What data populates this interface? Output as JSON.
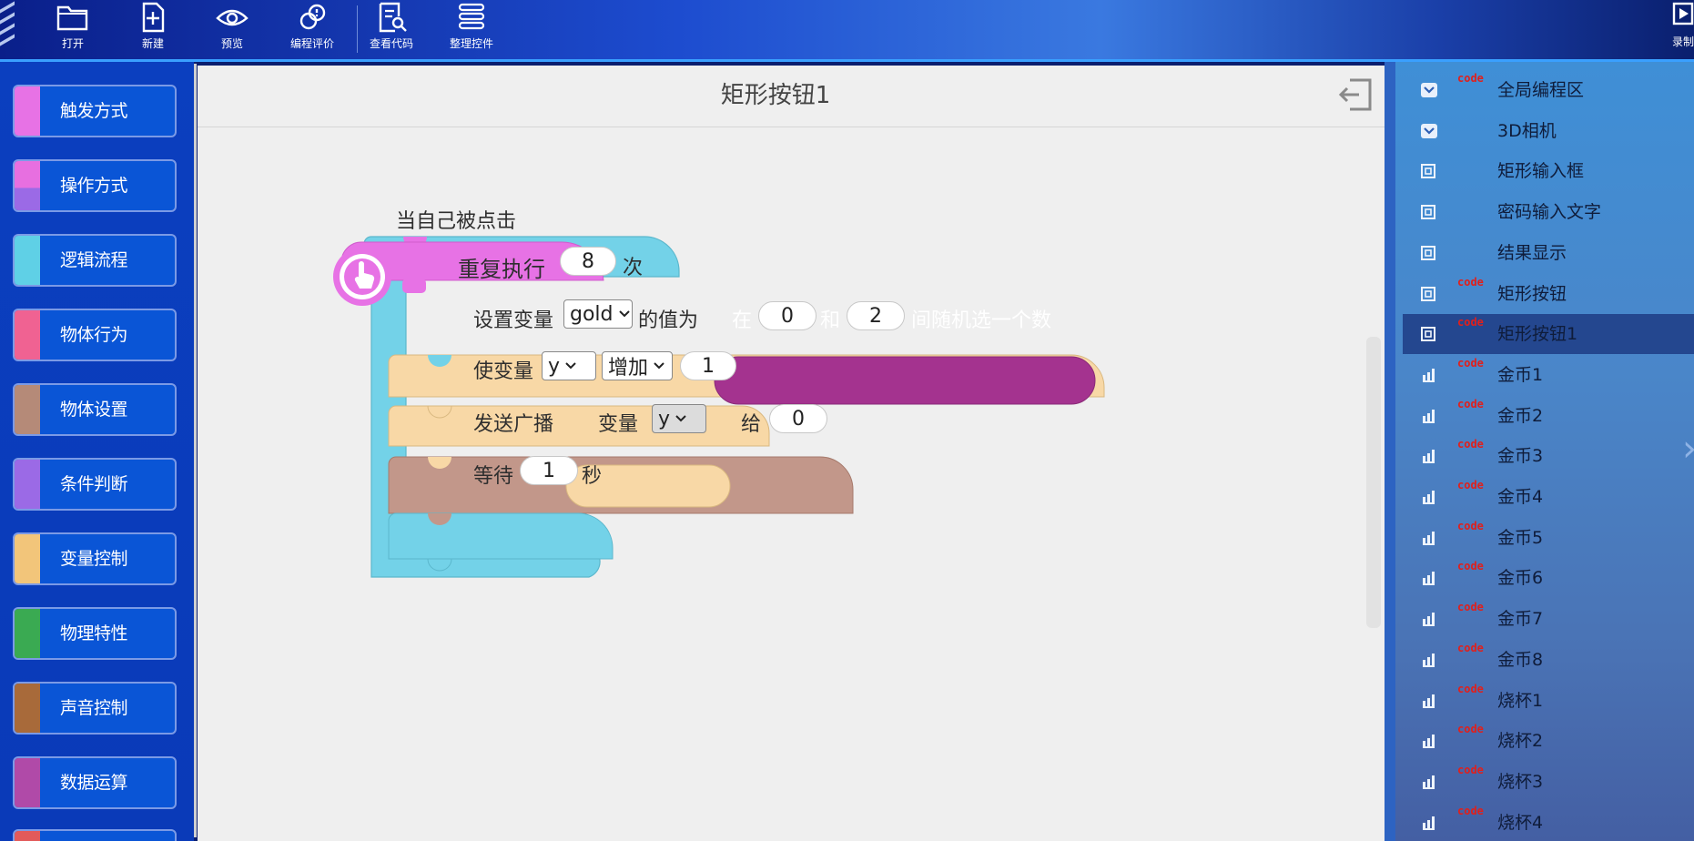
{
  "toolbar": {
    "items": [
      {
        "label": "打开",
        "icon": "folder-icon"
      },
      {
        "label": "新建",
        "icon": "new-file-icon"
      },
      {
        "label": "预览",
        "icon": "eye-icon"
      },
      {
        "label": "编程评价",
        "icon": "evaluate-icon"
      },
      {
        "label": "查看代码",
        "icon": "view-code-icon"
      },
      {
        "label": "整理控件",
        "icon": "organize-icon"
      }
    ],
    "record_label": "录制"
  },
  "categories": [
    {
      "label": "触发方式",
      "color": "#e772e5"
    },
    {
      "label": "操作方式",
      "color": "#e76fe0"
    },
    {
      "label": "逻辑流程",
      "color": "#5fd0e6"
    },
    {
      "label": "物体行为",
      "color": "#f06292"
    },
    {
      "label": "物体设置",
      "color": "#b58a78"
    },
    {
      "label": "条件判断",
      "color": "#9b6ae6"
    },
    {
      "label": "变量控制",
      "color": "#f2c57a"
    },
    {
      "label": "物理特性",
      "color": "#3aaa52"
    },
    {
      "label": "声音控制",
      "color": "#a86a3a"
    },
    {
      "label": "数据运算",
      "color": "#b04aa8"
    }
  ],
  "workspace": {
    "title": "矩形按钮1",
    "blocks": {
      "event": {
        "label": "当自己被点击"
      },
      "repeat": {
        "label": "重复执行",
        "count": "8",
        "unit": "次"
      },
      "set_var": {
        "label": "设置变量",
        "var": "gold",
        "mid": "的值为",
        "random": {
          "pre": "在",
          "a": "0",
          "and": "和",
          "b": "2",
          "post": "间随机选一个数"
        }
      },
      "change_var": {
        "label": "使变量",
        "var": "y",
        "op": "增加",
        "value": "1"
      },
      "broadcast": {
        "label": "发送广播",
        "var_label": "变量",
        "var": "y",
        "to": "给",
        "target": "0"
      },
      "wait": {
        "label": "等待",
        "value": "1",
        "unit": "秒"
      }
    }
  },
  "layers": [
    {
      "name": "全局编程区",
      "icon": "collapse-icon",
      "code": true
    },
    {
      "name": "3D相机",
      "icon": "collapse-icon",
      "code": false
    },
    {
      "name": "矩形输入框",
      "icon": "widget-icon",
      "code": false
    },
    {
      "name": "密码输入文字",
      "icon": "widget-icon",
      "code": false
    },
    {
      "name": "结果显示",
      "icon": "widget-icon",
      "code": false
    },
    {
      "name": "矩形按钮",
      "icon": "widget-icon",
      "code": true
    },
    {
      "name": "矩形按钮1",
      "icon": "widget-icon",
      "code": true,
      "selected": true
    },
    {
      "name": "金币1",
      "icon": "bar-chart-icon",
      "code": true
    },
    {
      "name": "金币2",
      "icon": "bar-chart-icon",
      "code": true
    },
    {
      "name": "金币3",
      "icon": "bar-chart-icon",
      "code": true
    },
    {
      "name": "金币4",
      "icon": "bar-chart-icon",
      "code": true
    },
    {
      "name": "金币5",
      "icon": "bar-chart-icon",
      "code": true
    },
    {
      "name": "金币6",
      "icon": "bar-chart-icon",
      "code": true
    },
    {
      "name": "金币7",
      "icon": "bar-chart-icon",
      "code": true
    },
    {
      "name": "金币8",
      "icon": "bar-chart-icon",
      "code": true
    },
    {
      "name": "烧杯1",
      "icon": "bar-chart-icon",
      "code": true
    },
    {
      "name": "烧杯2",
      "icon": "bar-chart-icon",
      "code": true
    },
    {
      "name": "烧杯3",
      "icon": "bar-chart-icon",
      "code": true
    },
    {
      "name": "烧杯4",
      "icon": "bar-chart-icon",
      "code": true
    }
  ],
  "code_badge": "code"
}
